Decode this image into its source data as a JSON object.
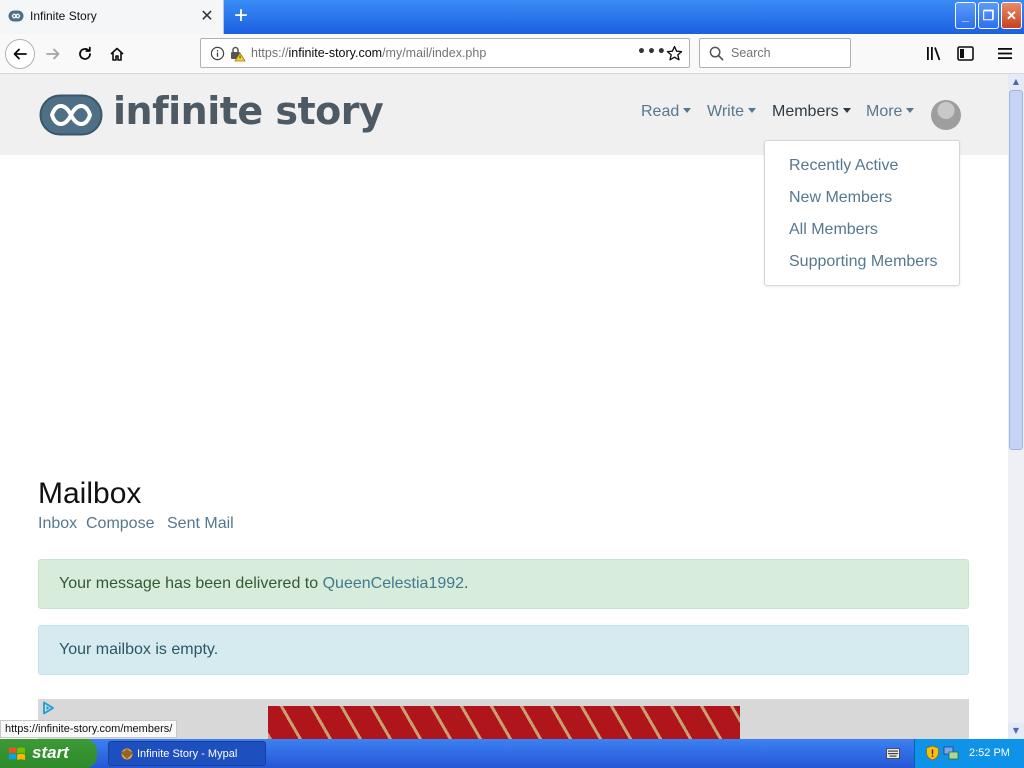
{
  "browser": {
    "tab_title": "Infinite Story",
    "url_prefix": "https://",
    "url_domain": "infinite-story.com",
    "url_path": "/my/mail/index.php",
    "search_placeholder": "Search",
    "status_url": "https://infinite-story.com/members/"
  },
  "site": {
    "logo_text": "infinite story",
    "nav": {
      "read": "Read",
      "write": "Write",
      "members": "Members",
      "more": "More"
    },
    "members_dropdown": [
      "Recently Active",
      "New Members",
      "All Members",
      "Supporting Members"
    ]
  },
  "main": {
    "title": "Mailbox",
    "sub_links": [
      "Inbox",
      "Compose",
      "Sent Mail"
    ],
    "success_message_prefix": "Your message has been delivered to",
    "success_recipient": "QueenCelestia1992",
    "success_message_suffix": ".",
    "info_message": "Your mailbox is empty."
  },
  "taskbar": {
    "start_label": "start",
    "task_item": "Infinite Story - Mypal",
    "clock": "2:52 PM"
  },
  "colors": {
    "link": "#56788e",
    "alert_success_bg": "#d8ecdc",
    "alert_info_bg": "#d6ebf0",
    "header_bg": "#f0f0f0",
    "taskbar_blue": "#2657d6",
    "start_green": "#3c9a37"
  }
}
